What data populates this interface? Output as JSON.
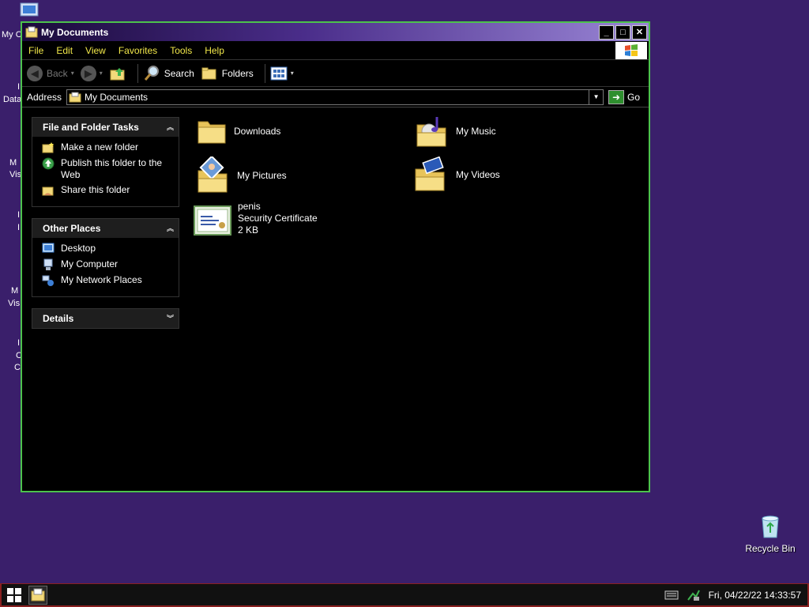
{
  "desktop": {
    "fragments": [
      "My C",
      "I",
      "Data",
      "M",
      "Vis",
      "I",
      "I",
      "M",
      "Vis",
      "I",
      "C",
      "C"
    ],
    "recycle_bin_label": "Recycle Bin"
  },
  "window": {
    "title": "My Documents",
    "buttons": {
      "minimize": "_",
      "maximize": "□",
      "close": "✕"
    }
  },
  "menu": [
    "File",
    "Edit",
    "View",
    "Favorites",
    "Tools",
    "Help"
  ],
  "toolbar": {
    "back_label": "Back",
    "search_label": "Search",
    "folders_label": "Folders"
  },
  "address": {
    "label": "Address",
    "value": "My Documents",
    "go_label": "Go"
  },
  "tasks": {
    "file_folder": {
      "title": "File and Folder Tasks",
      "items": [
        "Make a new folder",
        "Publish this folder to the Web",
        "Share this folder"
      ]
    },
    "other_places": {
      "title": "Other Places",
      "items": [
        "Desktop",
        "My Computer",
        "My Network Places"
      ]
    },
    "details": {
      "title": "Details"
    }
  },
  "files": [
    {
      "name": "Downloads"
    },
    {
      "name": "My Music"
    },
    {
      "name": "My Pictures"
    },
    {
      "name": "My Videos"
    },
    {
      "name": "penis",
      "type": "Security Certificate",
      "size": "2 KB"
    }
  ],
  "taskbar": {
    "clock": "Fri, 04/22/22 14:33:57"
  },
  "colors": {
    "desktop": "#3a1f6b",
    "menu_text": "#f2e84a",
    "window_border": "#4cc24c",
    "taskbar_border": "#8a2020"
  }
}
